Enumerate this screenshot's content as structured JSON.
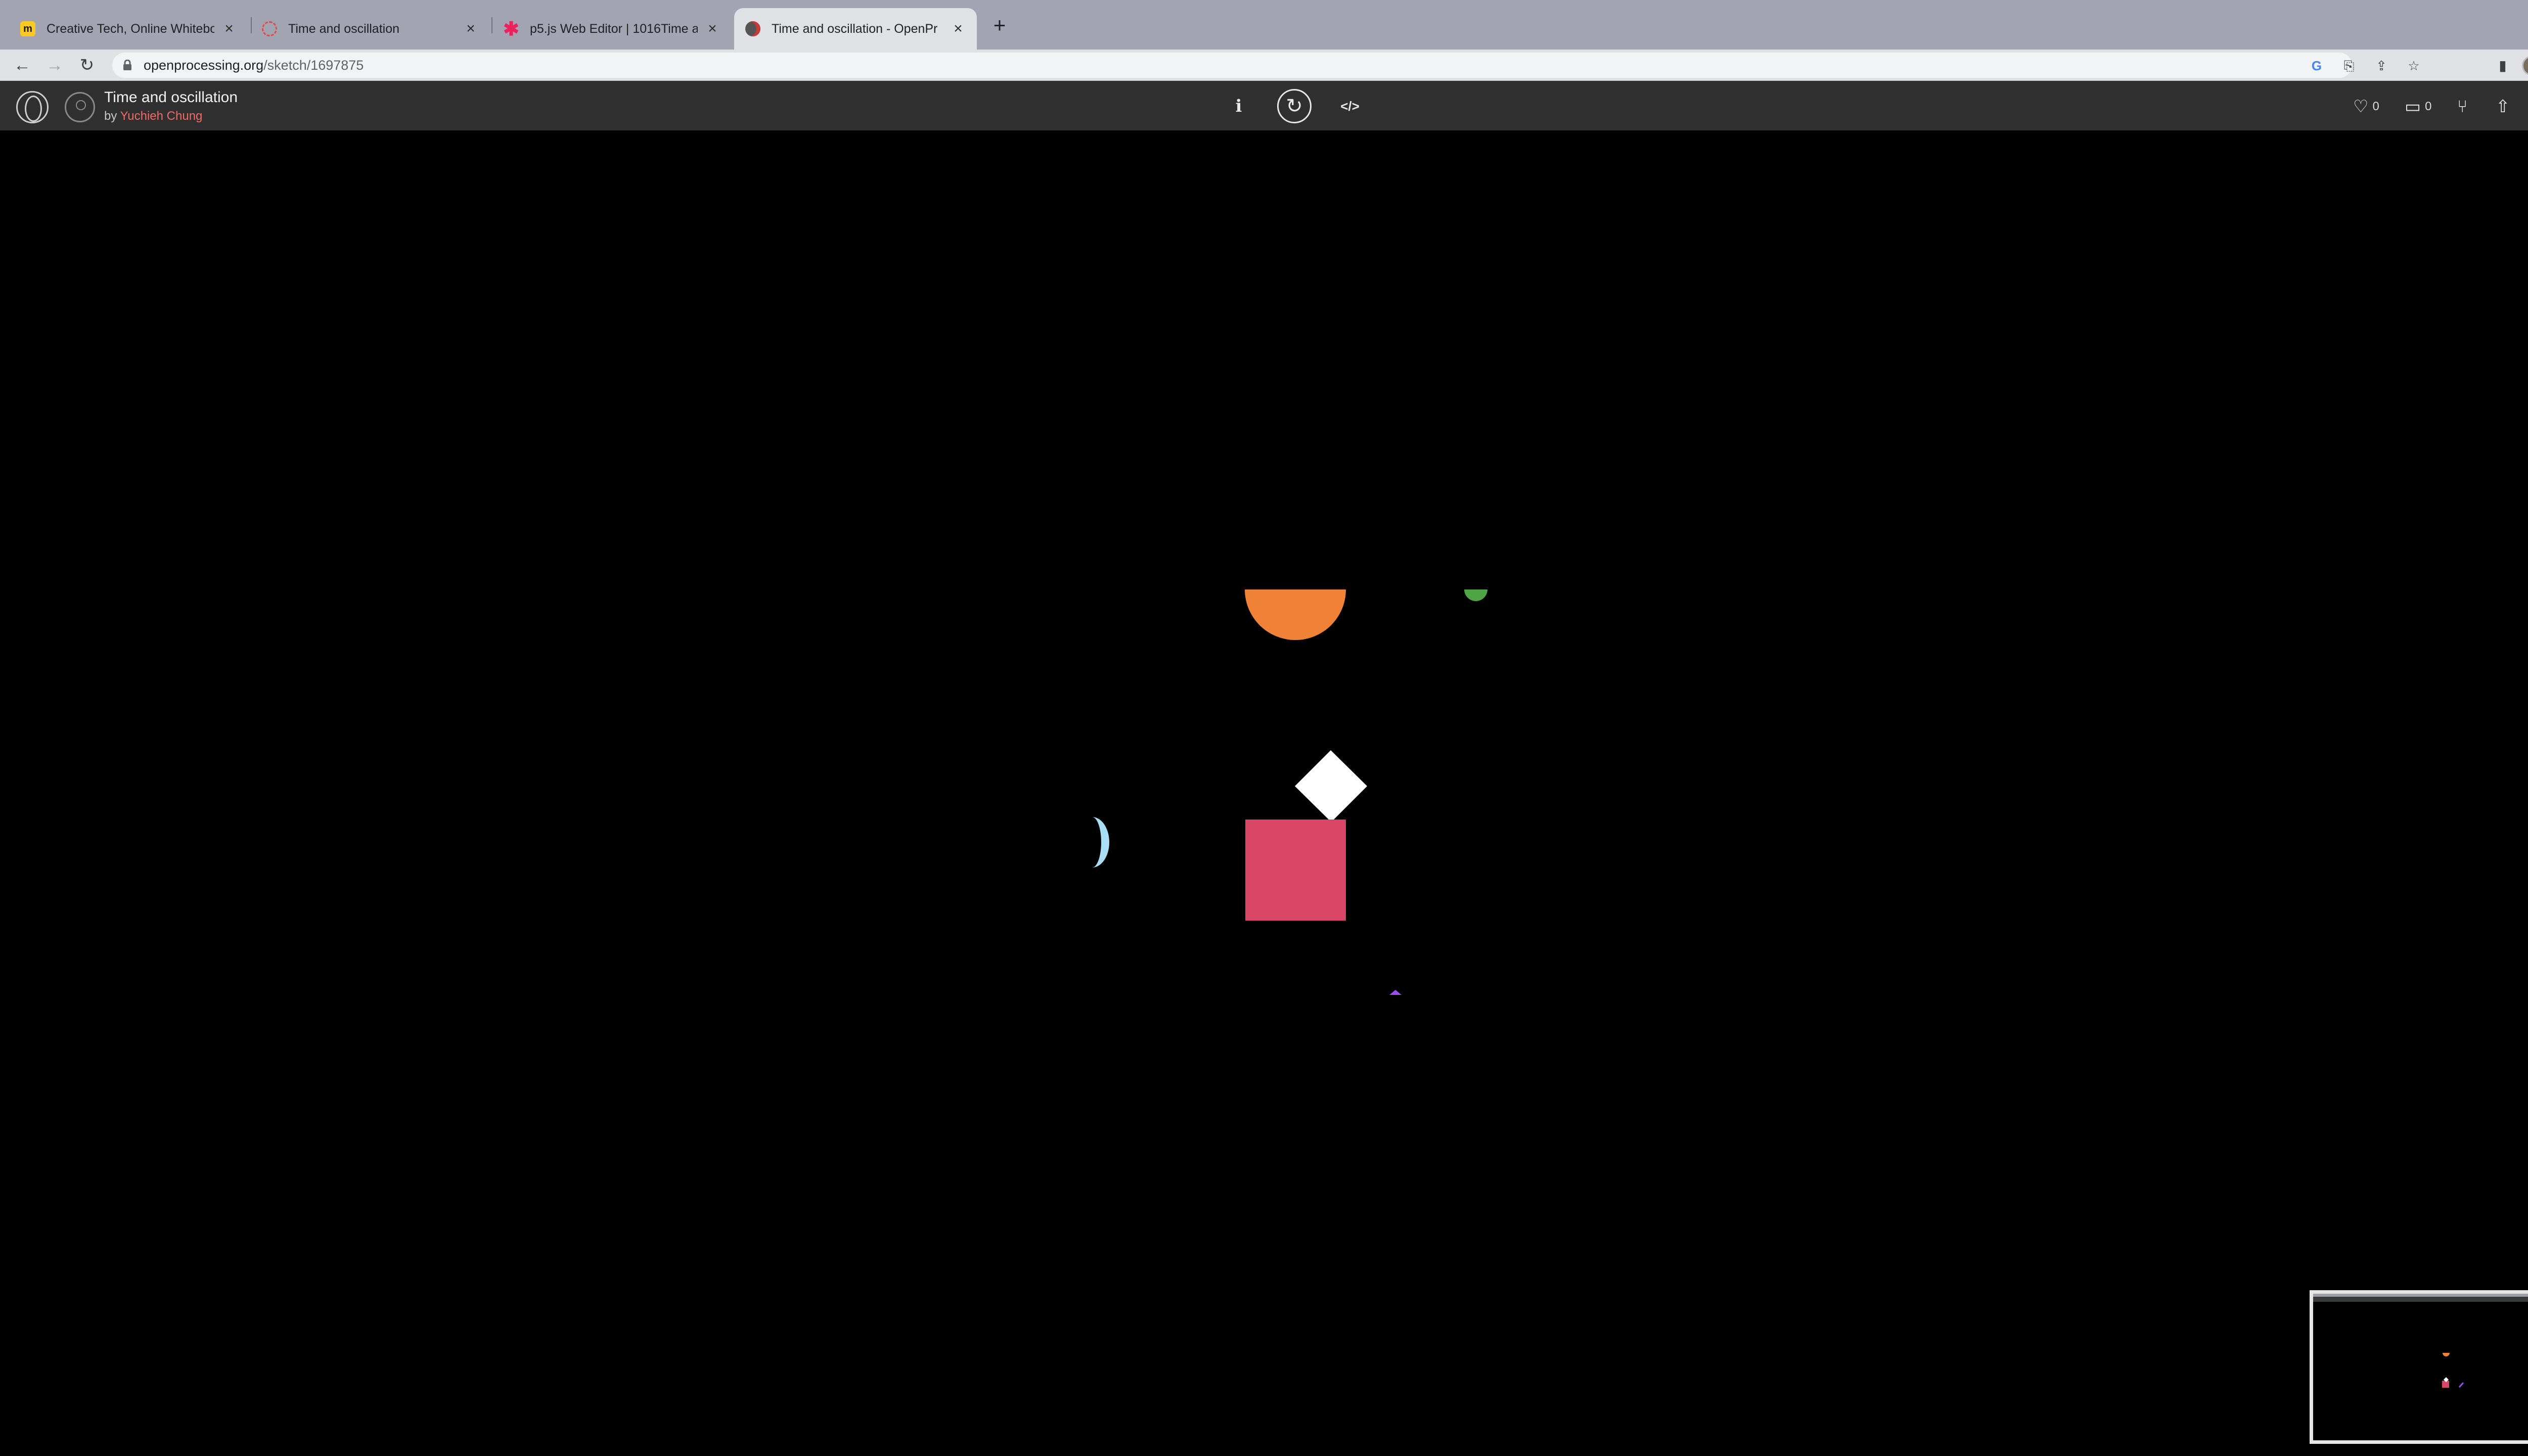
{
  "browser": {
    "tabs": [
      {
        "title": "Creative Tech, Online Whitebo",
        "icon": "miro-icon",
        "active": false
      },
      {
        "title": "Time and oscillation",
        "icon": "openprocessing-icon",
        "active": false
      },
      {
        "title": "p5.js Web Editor | 1016Time ar",
        "icon": "p5js-icon",
        "active": false
      },
      {
        "title": "Time and oscillation - OpenPr",
        "icon": "openprocessing-icon",
        "active": true
      }
    ],
    "url_host": "openprocessing.org",
    "url_path": "/sketch/1697875"
  },
  "sketch": {
    "title": "Time and oscillation",
    "by_prefix": "by",
    "author": "Yuchieh Chung",
    "likes": "0",
    "comments": "0",
    "info_label": "i",
    "code_label": "</>"
  },
  "colors": {
    "orange": "#ef8236",
    "green": "#4fa446",
    "white": "#ffffff",
    "pink": "#d94565",
    "light_blue": "#a9dcf5",
    "purple": "#9b4cf0",
    "author_link": "#f06b67"
  }
}
